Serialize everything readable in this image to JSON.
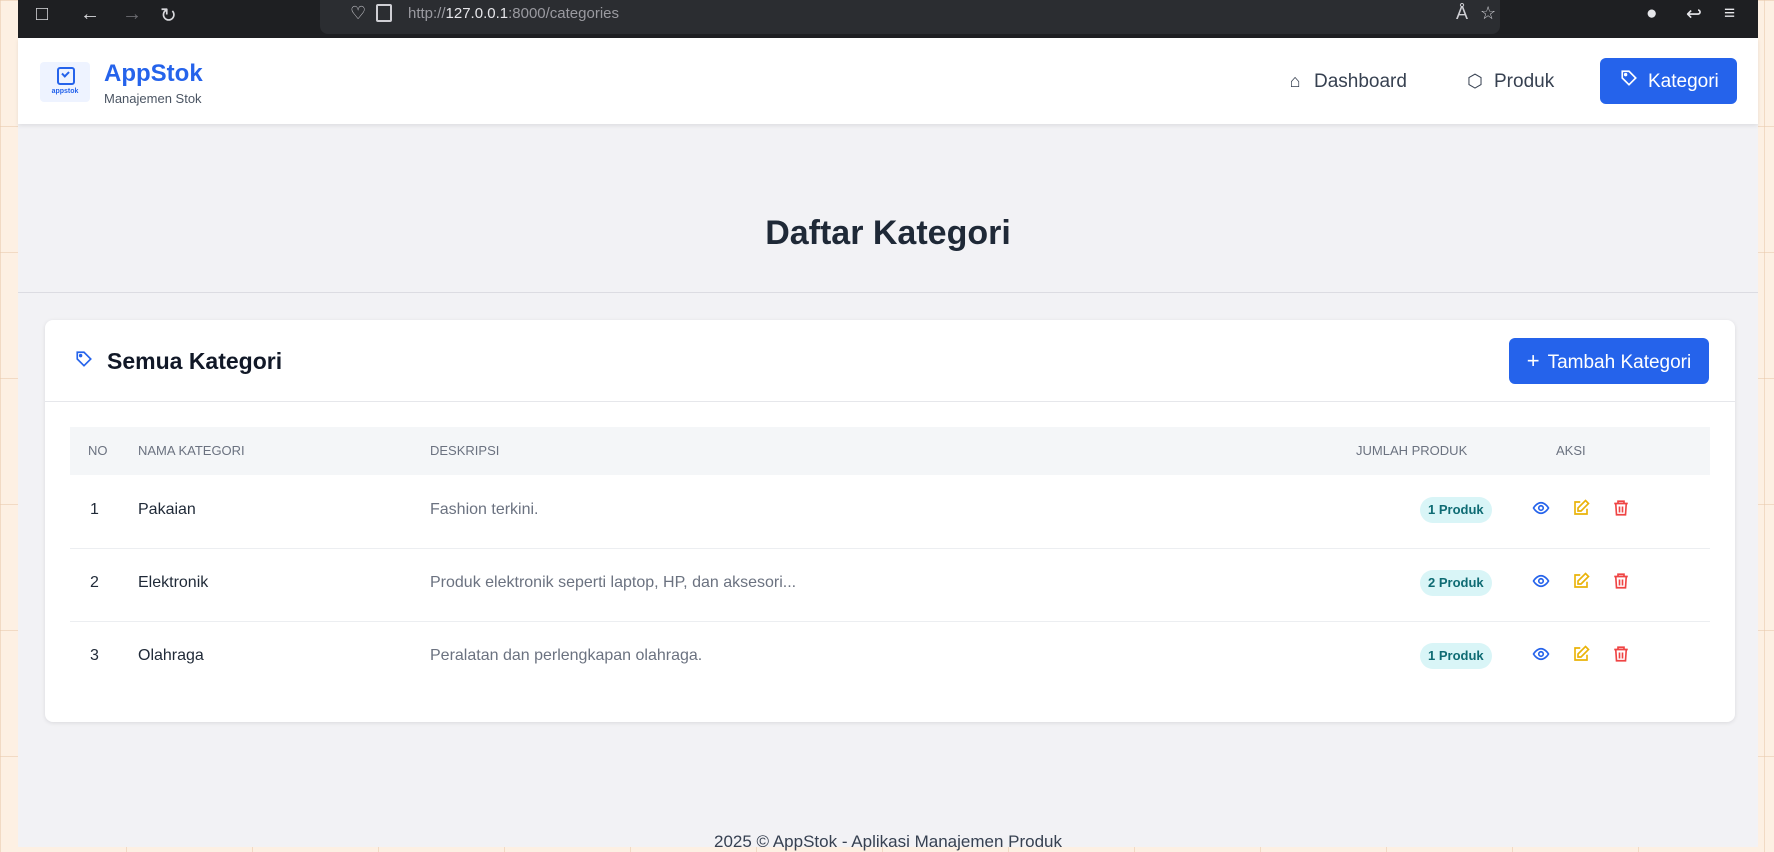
{
  "browser": {
    "url_prefix": "http://",
    "url_host": "127.0.0.1",
    "url_rest": ":8000/categories"
  },
  "brand": {
    "name": "AppStok",
    "subtitle": "Manajemen Stok",
    "logo_text": "appstok"
  },
  "nav": [
    {
      "label": "Dashboard",
      "icon": "home-icon"
    },
    {
      "label": "Produk",
      "icon": "box-icon"
    },
    {
      "label": "Kategori",
      "icon": "tag-icon",
      "active": true
    }
  ],
  "page": {
    "title": "Daftar Kategori"
  },
  "card": {
    "title": "Semua Kategori",
    "add_button": "Tambah Kategori"
  },
  "table": {
    "headers": [
      "NO",
      "NAMA KATEGORI",
      "DESKRIPSI",
      "JUMLAH PRODUK",
      "AKSI"
    ],
    "rows": [
      {
        "no": "1",
        "name": "Pakaian",
        "description": "Fashion terkini.",
        "count": "1 Produk"
      },
      {
        "no": "2",
        "name": "Elektronik",
        "description": "Produk elektronik seperti laptop, HP, dan aksesori...",
        "count": "2 Produk"
      },
      {
        "no": "3",
        "name": "Olahraga",
        "description": "Peralatan dan perlengkapan olahraga.",
        "count": "1 Produk"
      }
    ]
  },
  "footer": {
    "text": "2025 © AppStok - Aplikasi Manajemen Produk"
  },
  "colors": {
    "primary": "#2563eb",
    "view": "#2563eb",
    "edit": "#eab308",
    "delete": "#ef4444",
    "badge_bg": "#d9f5f7"
  }
}
